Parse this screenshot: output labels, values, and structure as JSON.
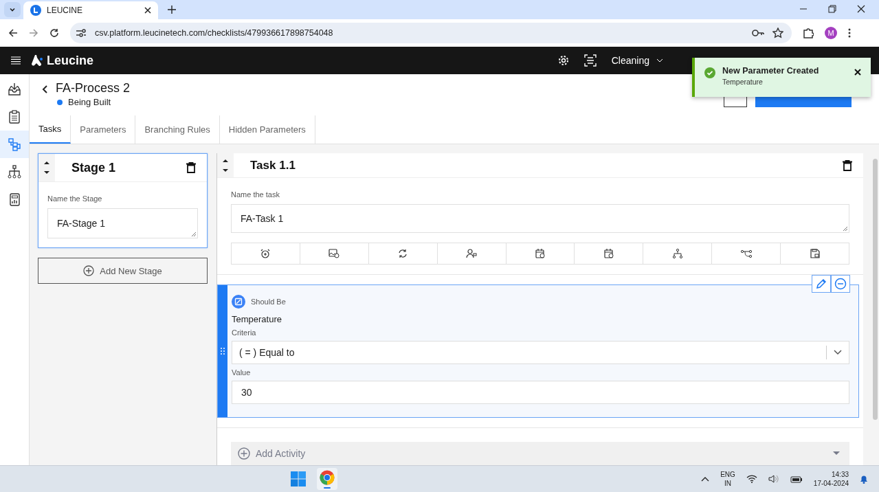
{
  "browser": {
    "tab_title": "LEUCINE",
    "url": "csv.platform.leucinetech.com/checklists/479936617898754048",
    "avatar": "M"
  },
  "header": {
    "brand": "Leucine",
    "facility": "Cleaning"
  },
  "toast": {
    "title": "New Parameter Created",
    "message": "Temperature"
  },
  "sidebar": {
    "items": [
      {
        "kind": "inbox",
        "selected": false
      },
      {
        "kind": "checklist",
        "selected": false
      },
      {
        "kind": "flow",
        "selected": true
      },
      {
        "kind": "hierarchy",
        "selected": false
      },
      {
        "kind": "report",
        "selected": false
      }
    ]
  },
  "page": {
    "title": "FA-Process 2",
    "status": "Being Built"
  },
  "tabs": [
    {
      "label": "Tasks",
      "selected": true
    },
    {
      "label": "Parameters",
      "selected": false
    },
    {
      "label": "Branching Rules",
      "selected": false
    },
    {
      "label": "Hidden Parameters",
      "selected": false
    }
  ],
  "stage": {
    "title": "Stage 1",
    "selected": true,
    "field_label": "Name the Stage",
    "value": "FA-Stage 1"
  },
  "add_stage": "Add New Stage",
  "task": {
    "title": "Task 1.1",
    "field_label": "Name the task",
    "value": "FA-Task 1",
    "actions": [
      {
        "kind": "alarm"
      },
      {
        "kind": "image"
      },
      {
        "kind": "refresh"
      },
      {
        "kind": "user-lock"
      },
      {
        "kind": "calendar-refresh"
      },
      {
        "kind": "calendar-clock"
      },
      {
        "kind": "hierarchy"
      },
      {
        "kind": "branch"
      },
      {
        "kind": "save-lock"
      }
    ]
  },
  "activity": {
    "type": "Should Be",
    "name": "Temperature",
    "criteria_label": "Criteria",
    "criteria": "( = ) Equal to",
    "value_label": "Value",
    "value": "30"
  },
  "add_activity": "Add Activity",
  "taskbar": {
    "language": "ENG",
    "region": "IN",
    "time": "14:33",
    "date": "17-04-2024"
  }
}
